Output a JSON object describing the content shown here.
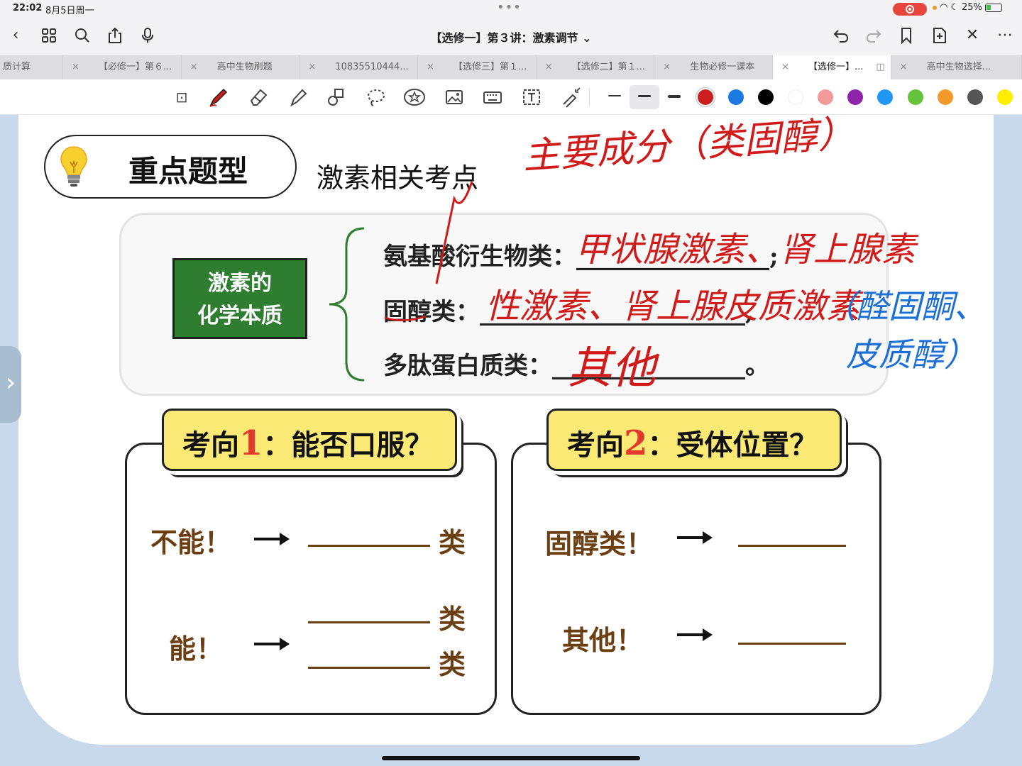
{
  "status": {
    "time": "22:02",
    "date": "8月5日周一",
    "battery": "25%"
  },
  "nav": {
    "title": "【选修一】第３讲：激素调节 ⌄"
  },
  "tabs": [
    {
      "label": "质计算",
      "active": false
    },
    {
      "label": "【必修一】第６...",
      "active": false
    },
    {
      "label": "高中生物刷题",
      "active": false
    },
    {
      "label": "10835510444...",
      "active": false
    },
    {
      "label": "【选修三】第１...",
      "active": false
    },
    {
      "label": "【选修二】第１...",
      "active": false
    },
    {
      "label": "生物必修一课本",
      "active": false
    },
    {
      "label": "【选修一】...",
      "active": true
    },
    {
      "label": "高中生物选择...",
      "active": false
    }
  ],
  "colors": {
    "palette": [
      "#cc1f1f",
      "#1a7ae0",
      "#000000",
      "#ffffff",
      "#f29999",
      "#8e24aa",
      "#2196f3",
      "#66c23a",
      "#f39a2a",
      "#555555",
      "#ffee00"
    ],
    "accent_green": "#2e7d31",
    "card_yellow": "#fbe975",
    "ink_red": "#d11a1a",
    "ink_blue": "#1d6fd8"
  },
  "slide": {
    "title": "重点题型",
    "subtitle": "激素相关考点",
    "green_box": [
      "激素的",
      "化学本质"
    ],
    "rows": [
      {
        "label": "氨基酸衍生物类：",
        "blank": "________________;"
      },
      {
        "label": "固醇类：",
        "blank": "______________________,"
      },
      {
        "label": "多肽蛋白质类：",
        "blank": "________________。"
      }
    ],
    "card1": {
      "head_prefix": "考向",
      "head_num": "1",
      "head_suffix": "：能否口服？",
      "cannot": "不能！",
      "can": "能！",
      "suffix": "类"
    },
    "card2": {
      "head_prefix": "考向",
      "head_num": "2",
      "head_suffix": "：受体位置？",
      "steroid": "固醇类！",
      "other": "其他！"
    }
  },
  "handwriting": {
    "red_top": "主要成分（类固醇）",
    "red_row1": "甲状腺激素、肾上腺素",
    "red_row2": "性激素、肾上腺皮质激素",
    "blue_note_1": "（醛固酮、",
    "blue_note_2": "皮质醇）",
    "red_row3": "其他"
  }
}
